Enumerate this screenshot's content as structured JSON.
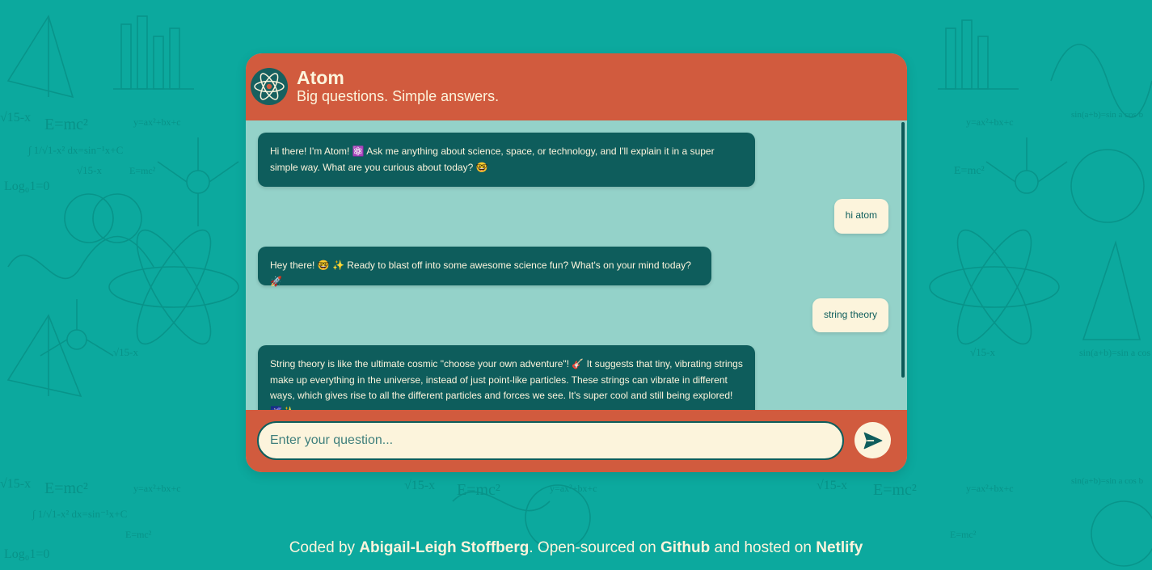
{
  "app": {
    "name": "Atom",
    "tagline": "Big questions. Simple answers."
  },
  "messages": [
    {
      "role": "bot",
      "text": "Hi there! I'm Atom! ⚛️ Ask me anything about science, space, or technology, and I'll explain it in a super simple way. What are you curious about today? 🤓"
    },
    {
      "role": "user",
      "text": "hi atom"
    },
    {
      "role": "bot",
      "text": "Hey there! 🤓 ✨ Ready to blast off into some awesome science fun? What's on your mind today? 🚀"
    },
    {
      "role": "user",
      "text": "string theory"
    },
    {
      "role": "bot",
      "text": "String theory is like the ultimate cosmic \"choose your own adventure\"! 🎸 It suggests that tiny, vibrating strings make up everything in the universe, instead of just point-like particles. These strings can vibrate in different ways, which gives rise to all the different particles and forces we see. It's super cool and still being explored! 🌌✨"
    }
  ],
  "input": {
    "placeholder": "Enter your question..."
  },
  "send_icon": "paper-plane-icon",
  "footer": {
    "prefix": "Coded by ",
    "author": "Abigail-Leigh Stoffberg",
    "middle": ". Open-sourced on ",
    "github": "Github",
    "and": " and hosted on ",
    "host": "Netlify"
  },
  "colors": {
    "background": "#0ca99e",
    "header": "#d15b3e",
    "chat_area": "#94d2c9",
    "bot_bubble": "#0e5d5c",
    "user_bubble": "#fcf4dc",
    "text_light": "#fcf4dc"
  }
}
